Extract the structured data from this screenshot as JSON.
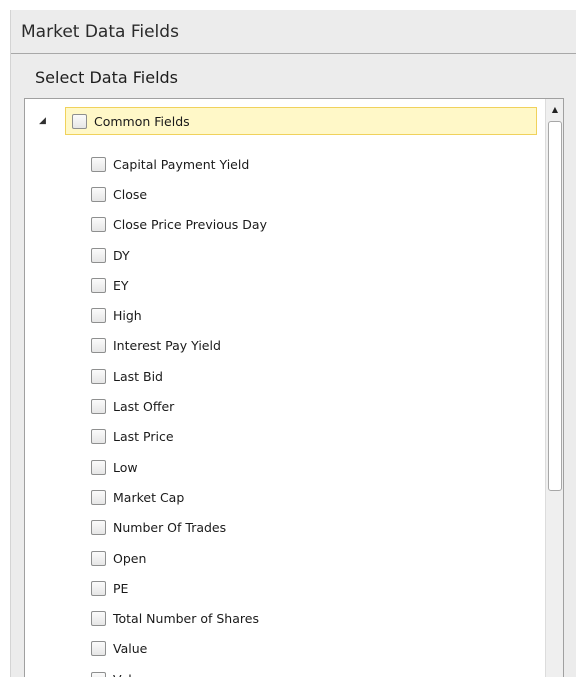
{
  "header": {
    "title": "Market Data Fields"
  },
  "section": {
    "label": "Select Data Fields"
  },
  "tree": {
    "root": {
      "label": "Common Fields",
      "expanded": true,
      "checked": false
    },
    "children": [
      {
        "label": "Capital Payment Yield",
        "checked": false
      },
      {
        "label": "Close",
        "checked": false
      },
      {
        "label": "Close Price Previous Day",
        "checked": false
      },
      {
        "label": "DY",
        "checked": false
      },
      {
        "label": "EY",
        "checked": false
      },
      {
        "label": "High",
        "checked": false
      },
      {
        "label": "Interest Pay Yield",
        "checked": false
      },
      {
        "label": "Last Bid",
        "checked": false
      },
      {
        "label": "Last Offer",
        "checked": false
      },
      {
        "label": "Last Price",
        "checked": false
      },
      {
        "label": "Low",
        "checked": false
      },
      {
        "label": "Market Cap",
        "checked": false
      },
      {
        "label": "Number Of Trades",
        "checked": false
      },
      {
        "label": "Open",
        "checked": false
      },
      {
        "label": "PE",
        "checked": false
      },
      {
        "label": "Total Number of Shares",
        "checked": false
      },
      {
        "label": "Value",
        "checked": false
      },
      {
        "label": "Volume",
        "checked": false
      }
    ]
  },
  "colors": {
    "selection_bg": "#fff8c8",
    "selection_border": "#f0d25c"
  }
}
